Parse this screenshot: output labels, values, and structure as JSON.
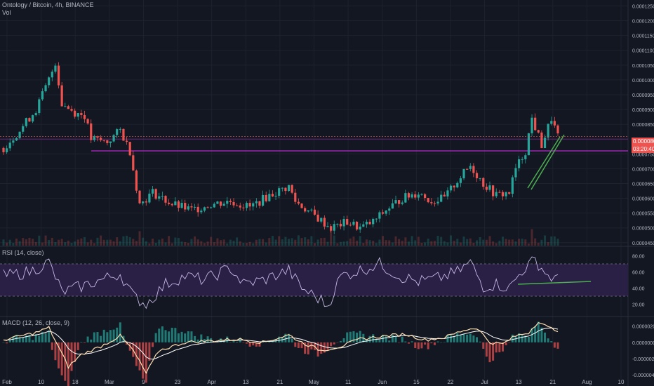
{
  "header": {
    "symbol_line": "Ontology / Bitcoin, 4h, BINANCE",
    "volume_label": "Vol"
  },
  "rsi_pane": {
    "label": "RSI (14, close)"
  },
  "macd_pane": {
    "label": "MACD (12, 26, close, 9)"
  },
  "price_tags": {
    "last_price": "0.0000809",
    "countdown": "03:20:40"
  },
  "colors": {
    "background": "#131722",
    "grid": "#1e222d",
    "candle_up": "#26a69a",
    "candle_down": "#ef5350",
    "support_line": "#9c27b0",
    "trendline": "#4caf50",
    "rsi_line": "#c7b7e6",
    "rsi_band": "#2a1f45",
    "macd_line": "#ffe0b2",
    "signal_line": "#ffffff",
    "price_tag": "#ef5350"
  },
  "chart_data": [
    {
      "type": "candlestick",
      "title": "Ontology / Bitcoin, 4h, BINANCE",
      "x_ticks": [
        "Feb",
        "10",
        "18",
        "Mar",
        "9",
        "23",
        "Apr",
        "13",
        "21",
        "May",
        "11",
        "Jun",
        "15",
        "22",
        "Jul",
        "13",
        "21",
        "Aug",
        "10"
      ],
      "y_ticks": [
        "0.0001250",
        "0.0001200",
        "0.0001150",
        "0.0001100",
        "0.0001050",
        "0.0001000",
        "0.0000950",
        "0.0000900",
        "0.0000850",
        "0.0000800",
        "0.0000750",
        "0.0000700",
        "0.0000650",
        "0.0000600",
        "0.0000550",
        "0.0000500",
        "0.0000450"
      ],
      "ylim": [
        4.4e-05,
        0.000127
      ],
      "price_path": [
        [
          0,
          7.7e-05
        ],
        [
          5,
          8.3e-05
        ],
        [
          10,
          9e-05
        ],
        [
          14,
          0.0001
        ],
        [
          16,
          0.000106
        ],
        [
          18,
          9.2e-05
        ],
        [
          22,
          8.9e-05
        ],
        [
          25,
          8.8e-05
        ],
        [
          27,
          8e-05
        ],
        [
          32,
          7.9e-05
        ],
        [
          36,
          8.3e-05
        ],
        [
          39,
          7.6e-05
        ],
        [
          42,
          5.8e-05
        ],
        [
          46,
          6.2e-05
        ],
        [
          52,
          5.8e-05
        ],
        [
          58,
          5.6e-05
        ],
        [
          64,
          5.8e-05
        ],
        [
          70,
          5.9e-05
        ],
        [
          76,
          5.7e-05
        ],
        [
          82,
          6.1e-05
        ],
        [
          88,
          6.4e-05
        ],
        [
          90,
          5.9e-05
        ],
        [
          96,
          5.4e-05
        ],
        [
          101,
          5e-05
        ],
        [
          106,
          5.2e-05
        ],
        [
          110,
          5e-05
        ],
        [
          114,
          5.2e-05
        ],
        [
          118,
          5.6e-05
        ],
        [
          123,
          6e-05
        ],
        [
          128,
          6.2e-05
        ],
        [
          132,
          5.9e-05
        ],
        [
          136,
          6e-05
        ],
        [
          140,
          6.6e-05
        ],
        [
          144,
          7.1e-05
        ],
        [
          148,
          6.5e-05
        ],
        [
          152,
          6.1e-05
        ],
        [
          156,
          6.2e-05
        ],
        [
          158,
          7e-05
        ],
        [
          161,
          7.6e-05
        ],
        [
          163,
          8.7e-05
        ],
        [
          166,
          7.8e-05
        ],
        [
          169,
          8.7e-05
        ],
        [
          171,
          8.09e-05
        ]
      ],
      "last_price": 8.09e-05,
      "support_level": 7.6e-05,
      "support_level_2": 8e-05
    },
    {
      "type": "line",
      "title": "RSI (14, close)",
      "y_ticks": [
        "80.00",
        "60.00",
        "40.00",
        "20.00"
      ],
      "ylim": [
        10,
        90
      ],
      "band": [
        30,
        70
      ],
      "path": [
        [
          0,
          55
        ],
        [
          8,
          60
        ],
        [
          14,
          72
        ],
        [
          18,
          35
        ],
        [
          24,
          42
        ],
        [
          30,
          50
        ],
        [
          36,
          58
        ],
        [
          40,
          30
        ],
        [
          44,
          20
        ],
        [
          50,
          45
        ],
        [
          56,
          55
        ],
        [
          62,
          50
        ],
        [
          70,
          65
        ],
        [
          74,
          45
        ],
        [
          80,
          50
        ],
        [
          88,
          62
        ],
        [
          92,
          40
        ],
        [
          98,
          25
        ],
        [
          100,
          18
        ],
        [
          104,
          55
        ],
        [
          110,
          62
        ],
        [
          116,
          70
        ],
        [
          122,
          55
        ],
        [
          128,
          48
        ],
        [
          134,
          52
        ],
        [
          140,
          60
        ],
        [
          144,
          72
        ],
        [
          148,
          42
        ],
        [
          152,
          45
        ],
        [
          156,
          40
        ],
        [
          160,
          62
        ],
        [
          164,
          75
        ],
        [
          168,
          55
        ],
        [
          171,
          50
        ]
      ]
    },
    {
      "type": "line",
      "title": "MACD (12, 26, close, 9)",
      "y_ticks": [
        "0.0000020",
        "0.0000000",
        "-0.0000020",
        "-0.0000040"
      ],
      "ylim": [
        -4.5e-06,
        3e-06
      ],
      "macd_path": [
        [
          0,
          3e-07
        ],
        [
          10,
          1.2e-06
        ],
        [
          14,
          1.8e-06
        ],
        [
          20,
          -3e-06
        ],
        [
          24,
          -1.5e-06
        ],
        [
          30,
          -5e-07
        ],
        [
          36,
          8e-07
        ],
        [
          40,
          -1e-06
        ],
        [
          44,
          -3.8e-06
        ],
        [
          48,
          -1e-06
        ],
        [
          56,
          0.0
        ],
        [
          64,
          2e-07
        ],
        [
          72,
          4e-07
        ],
        [
          80,
          0.0
        ],
        [
          88,
          9e-07
        ],
        [
          92,
          0.0
        ],
        [
          98,
          -1e-06
        ],
        [
          104,
          -5e-07
        ],
        [
          110,
          4e-07
        ],
        [
          118,
          8e-07
        ],
        [
          124,
          1e-06
        ],
        [
          130,
          3e-07
        ],
        [
          136,
          6e-07
        ],
        [
          142,
          1.5e-06
        ],
        [
          146,
          1.8e-06
        ],
        [
          150,
          0.0
        ],
        [
          154,
          -2e-07
        ],
        [
          158,
          8e-07
        ],
        [
          162,
          1.2e-06
        ],
        [
          165,
          2.6e-06
        ],
        [
          168,
          1.8e-06
        ],
        [
          171,
          1.5e-06
        ]
      ]
    }
  ]
}
